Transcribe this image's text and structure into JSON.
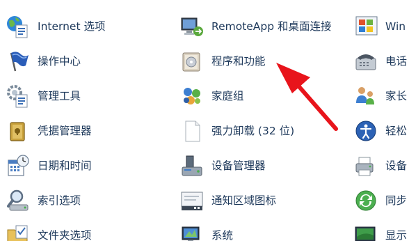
{
  "control_panel": {
    "columns": [
      [
        {
          "label": "Internet 选项",
          "icon": "internet-options-icon"
        },
        {
          "label": "操作中心",
          "icon": "action-center-flag-icon"
        },
        {
          "label": "管理工具",
          "icon": "administrative-tools-icon"
        },
        {
          "label": "凭据管理器",
          "icon": "credential-manager-icon"
        },
        {
          "label": "日期和时间",
          "icon": "date-time-icon"
        },
        {
          "label": "索引选项",
          "icon": "indexing-options-icon"
        },
        {
          "label": "文件夹选项",
          "icon": "folder-options-icon"
        }
      ],
      [
        {
          "label": "RemoteApp 和桌面连接",
          "icon": "remoteapp-icon"
        },
        {
          "label": "程序和功能",
          "icon": "programs-features-icon"
        },
        {
          "label": "家庭组",
          "icon": "homegroup-icon"
        },
        {
          "label": "强力卸载 (32 位)",
          "icon": "uninstaller-document-icon"
        },
        {
          "label": "设备管理器",
          "icon": "device-manager-icon"
        },
        {
          "label": "通知区域图标",
          "icon": "notification-area-icons-icon"
        },
        {
          "label": "系统",
          "icon": "system-icon"
        }
      ],
      [
        {
          "label": "Win",
          "icon": "windows-update-icon"
        },
        {
          "label": "电话",
          "icon": "phone-modem-icon"
        },
        {
          "label": "家长",
          "icon": "parental-controls-icon"
        },
        {
          "label": "轻松",
          "icon": "ease-of-access-icon"
        },
        {
          "label": "设备",
          "icon": "devices-printers-icon"
        },
        {
          "label": "同步",
          "icon": "sync-center-icon"
        },
        {
          "label": "显示",
          "icon": "display-icon"
        }
      ]
    ],
    "annotation": {
      "icon": "red-arrow-icon",
      "color": "#e8141b"
    }
  }
}
